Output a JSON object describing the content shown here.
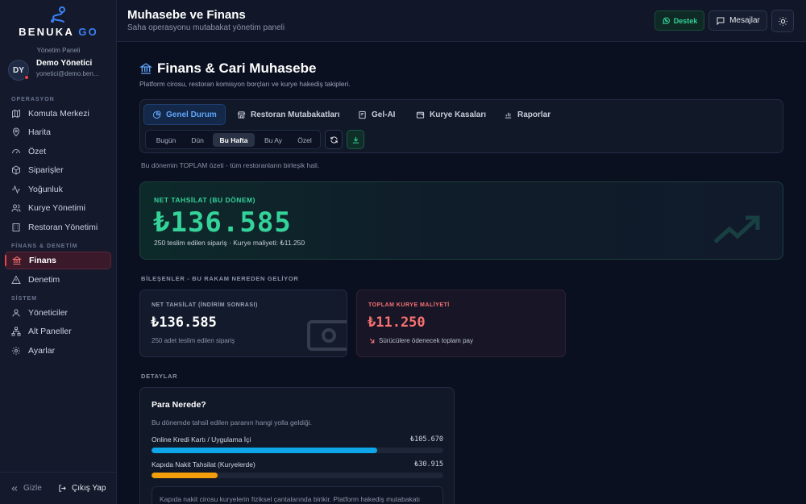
{
  "brand": {
    "name_part1": "BENUKA",
    "name_part2": "GO",
    "panel_label": "Yönetim Paneli"
  },
  "user": {
    "initials": "DY",
    "name": "Demo Yönetici",
    "email": "yonetici@demo.ben..."
  },
  "sidebar": {
    "sections": [
      {
        "title": "OPERASYON",
        "items": [
          {
            "label": "Komuta Merkezi",
            "icon": "map-icon"
          },
          {
            "label": "Harita",
            "icon": "map-pin-icon"
          },
          {
            "label": "Özet",
            "icon": "gauge-icon"
          },
          {
            "label": "Siparişler",
            "icon": "box-icon"
          },
          {
            "label": "Yoğunluk",
            "icon": "activity-icon"
          },
          {
            "label": "Kurye Yönetimi",
            "icon": "users-icon"
          },
          {
            "label": "Restoran Yönetimi",
            "icon": "building-icon"
          }
        ]
      },
      {
        "title": "FİNANS & DENETİM",
        "items": [
          {
            "label": "Finans",
            "icon": "bank-icon",
            "active": true
          },
          {
            "label": "Denetim",
            "icon": "alert-triangle-icon"
          }
        ]
      },
      {
        "title": "SİSTEM",
        "items": [
          {
            "label": "Yöneticiler",
            "icon": "user-icon"
          },
          {
            "label": "Alt Paneller",
            "icon": "network-icon"
          },
          {
            "label": "Ayarlar",
            "icon": "gear-icon"
          }
        ]
      }
    ],
    "footer": {
      "hide_label": "Gizle",
      "logout_label": "Çıkış Yap"
    }
  },
  "header": {
    "title": "Muhasebe ve Finans",
    "subtitle": "Saha operasyonu mutabakat yönetim paneli",
    "support_label": "Destek",
    "messages_label": "Mesajlar"
  },
  "page": {
    "title": "Finans & Cari Muhasebe",
    "subtitle": "Platform cirosu, restoran komisyon borçları ve kurye hakediş takipleri."
  },
  "tabs": [
    {
      "label": "Genel Durum",
      "active": true
    },
    {
      "label": "Restoran Mutabakatları"
    },
    {
      "label": "Gel-AI"
    },
    {
      "label": "Kurye Kasaları"
    },
    {
      "label": "Raporlar"
    }
  ],
  "periods": [
    {
      "label": "Bugün"
    },
    {
      "label": "Dün"
    },
    {
      "label": "Bu Hafta",
      "active": true
    },
    {
      "label": "Bu Ay"
    },
    {
      "label": "Özel"
    }
  ],
  "note": "Bu dönemin TOPLAM özeti - tüm restoranların birleşik hali.",
  "hero": {
    "label": "NET TAHSİLAT (BU DÖNEM)",
    "value": "₺136.585",
    "meta": "250 teslim edilen sipariş · Kurye maliyeti: ₺11.250"
  },
  "components": {
    "heading": "BİLEŞENLER - BU RAKAM NEREDEN GELİYOR",
    "cards": [
      {
        "label": "NET TAHSİLAT (İNDİRİM SONRASI)",
        "value": "₺136.585",
        "meta": "250 adet teslim edilen sipariş",
        "color": "#9aa3b8"
      },
      {
        "label": "TOPLAM KURYE MALİYETİ",
        "value": "₺11.250",
        "meta": "Sürücülere ödenecek toplam pay",
        "color": "#f87171"
      }
    ]
  },
  "details": {
    "heading": "DETAYLAR",
    "title": "Para Nerede?",
    "subtitle": "Bu dönemde tahsil edilen paranın hangi yolla geldiği.",
    "rows": [
      {
        "label": "Online Kredi Kartı / Uygulama İçi",
        "amount": "₺105.670",
        "share": 0.774,
        "color": "#0ea5e9"
      },
      {
        "label": "Kapıda Nakit Tahsilat (Kuryelerde)",
        "amount": "₺30.915",
        "share": 0.226,
        "color": "#f59e0b"
      }
    ],
    "info": "Kapıda nakit cirosu kuryelerin fiziksel çantalarında birikir. Platform hakediş mutabakatı"
  },
  "colors": {
    "accent": "#3b82f6",
    "positive": "#34d399",
    "negative": "#f87171",
    "danger": "#ef4444"
  }
}
